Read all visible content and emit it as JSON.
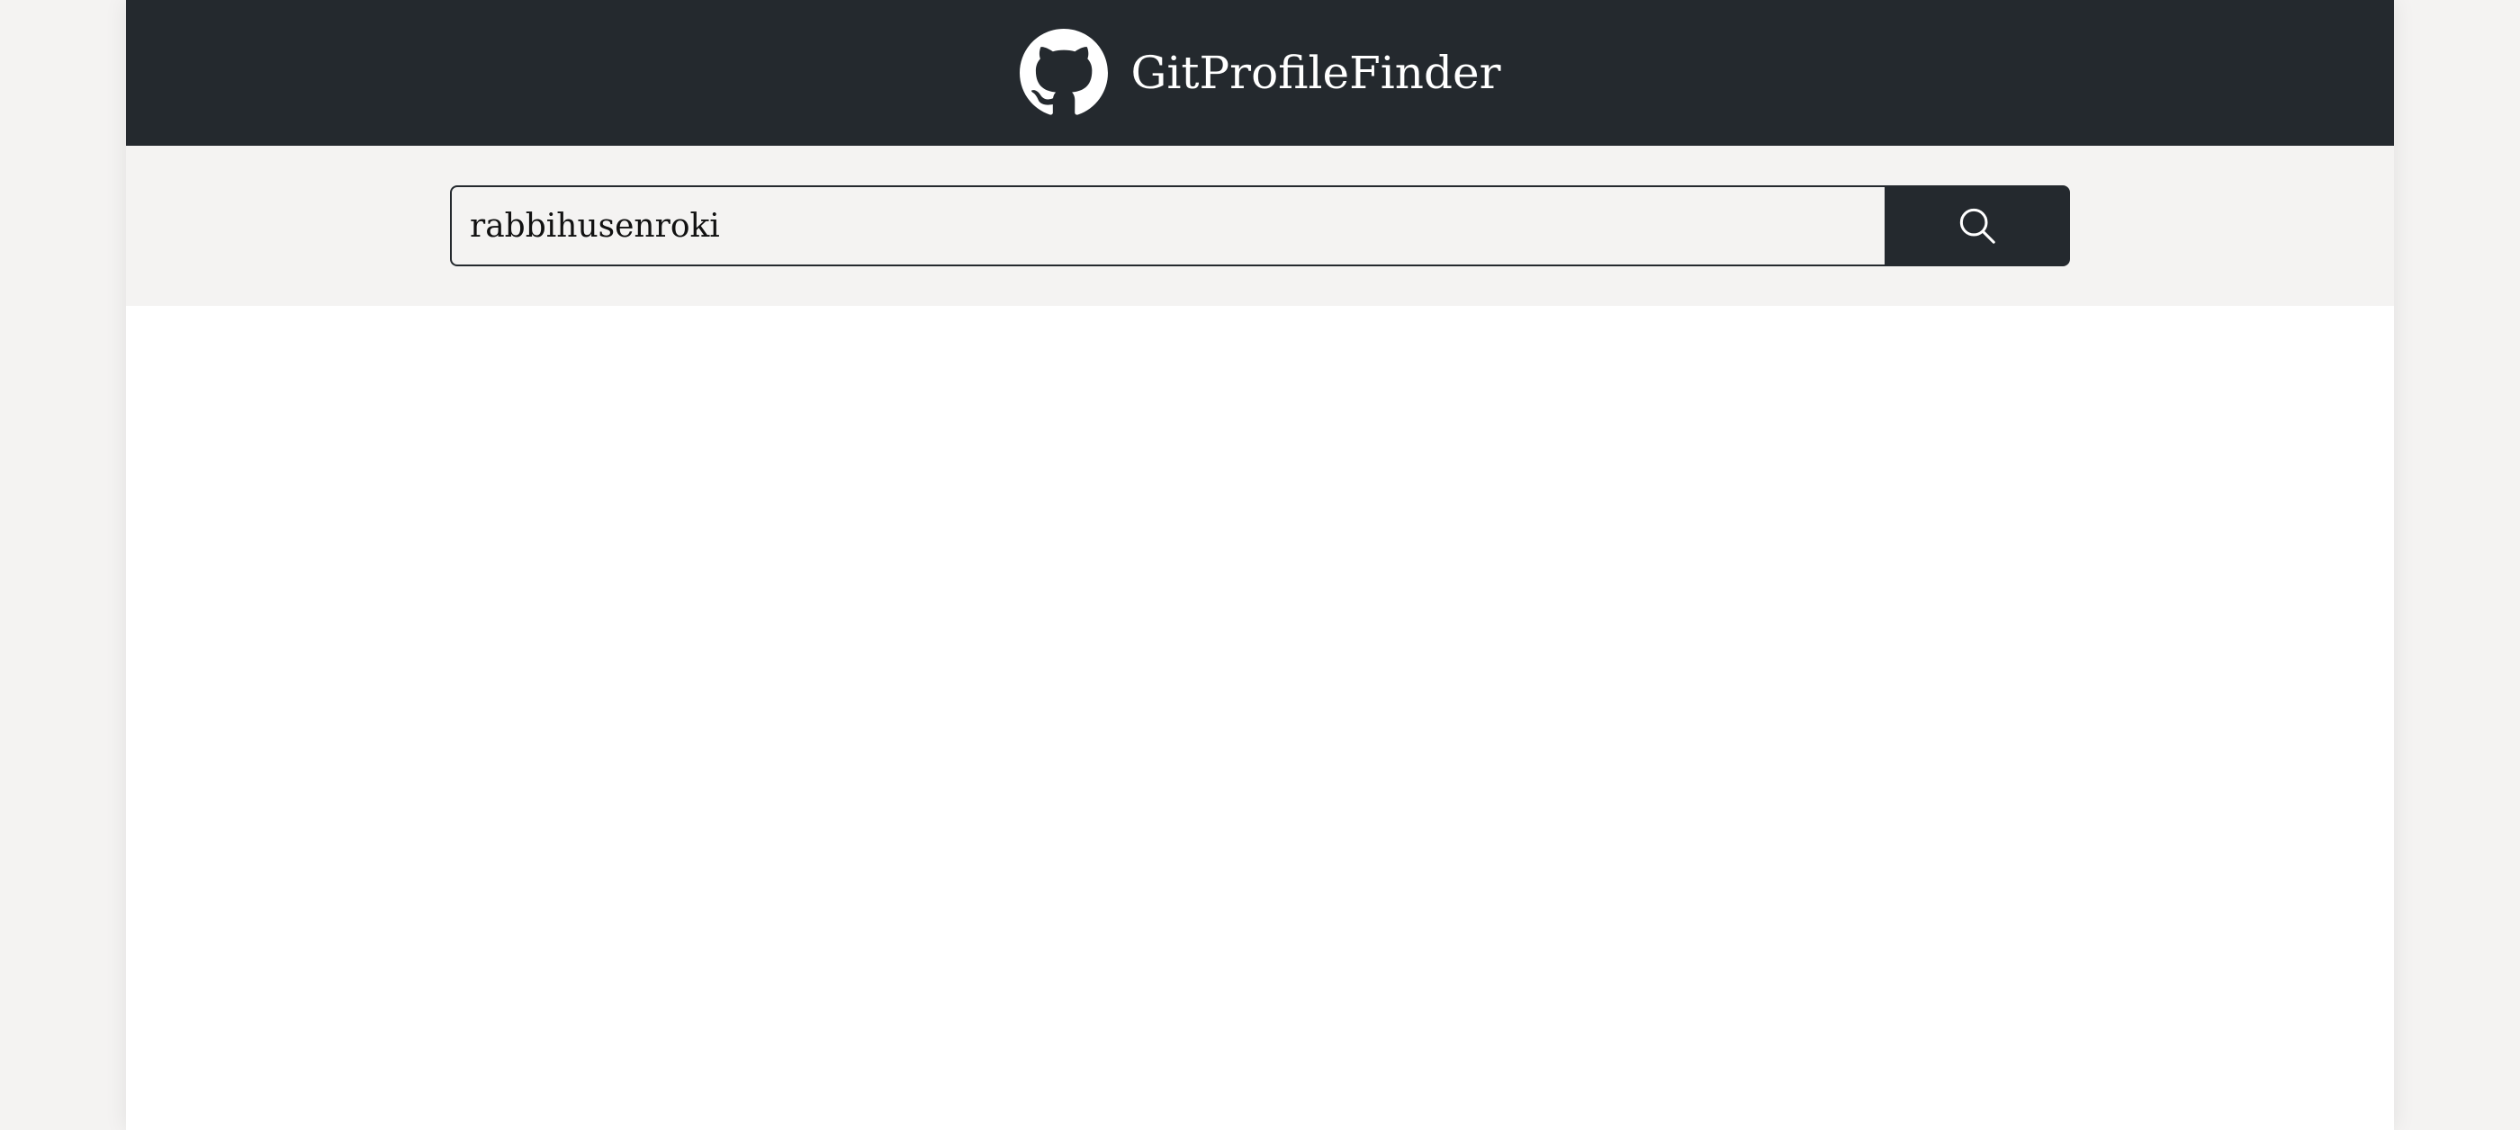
{
  "header": {
    "title": "GitProfileFinder",
    "logo_icon": "github-octocat-icon"
  },
  "search": {
    "value": "rabbihusenroki",
    "button_icon": "search-icon"
  },
  "colors": {
    "header_bg": "#24292e",
    "search_band_bg": "#f4f3f2",
    "page_bg": "#ffffff"
  }
}
